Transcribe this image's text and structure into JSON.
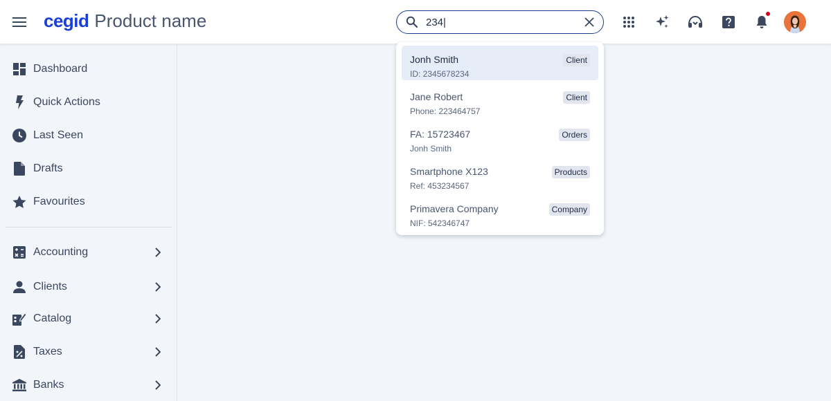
{
  "header": {
    "logo": "cegid",
    "product_name": "Product name",
    "search": {
      "value": "234|",
      "placeholder": ""
    },
    "icons": [
      "menu-icon",
      "apps-grid-icon",
      "sparkle-icon",
      "headset-icon",
      "help-icon",
      "bell-icon"
    ],
    "notification_dot_color": "#d0021b",
    "avatar_color": "#e8743b"
  },
  "sidebar": {
    "items": [
      {
        "label": "Dashboard",
        "icon": "dashboard-icon"
      },
      {
        "label": "Quick Actions",
        "icon": "bolt-icon"
      },
      {
        "label": "Last Seen",
        "icon": "clock-icon"
      },
      {
        "label": "Drafts",
        "icon": "document-icon"
      },
      {
        "label": "Favourites",
        "icon": "star-icon"
      }
    ],
    "groups": [
      {
        "label": "Accounting",
        "icon": "calculator-icon"
      },
      {
        "label": "Clients",
        "icon": "person-icon"
      },
      {
        "label": "Catalog",
        "icon": "catalog-icon"
      },
      {
        "label": "Taxes",
        "icon": "tax-icon"
      },
      {
        "label": "Banks",
        "icon": "bank-icon"
      }
    ]
  },
  "search_results": [
    {
      "title": "Jonh Smith",
      "subtitle": "ID: 2345678234",
      "tag": "Client",
      "active": true
    },
    {
      "title": "Jane Robert",
      "subtitle": "Phone: 223464757",
      "tag": "Client"
    },
    {
      "title": "FA: 15723467",
      "subtitle": "Jonh Smith",
      "tag": "Orders"
    },
    {
      "title": "Smartphone X123",
      "subtitle": "Ref: 453234567",
      "tag": "Products"
    },
    {
      "title": "Primavera Company",
      "subtitle": "NIF: 542346747",
      "tag": "Company"
    }
  ],
  "colors": {
    "brand": "#1a3fd9",
    "icon": "#3b475f",
    "active_row": "#e6edf9",
    "background": "#f2f5f9"
  }
}
